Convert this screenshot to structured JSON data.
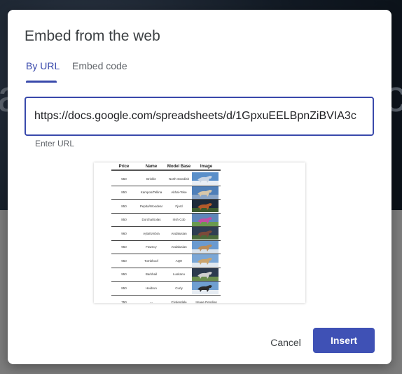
{
  "dialog": {
    "title": "Embed from the web",
    "tabs": [
      {
        "label": "By URL",
        "active": true
      },
      {
        "label": "Embed code",
        "active": false
      }
    ],
    "url_field": {
      "value": "https://docs.google.com/spreadsheets/d/1GpxuEELBpnZiBVIA3c",
      "helper": "Enter URL"
    },
    "cancel_label": "Cancel",
    "insert_label": "Insert"
  },
  "preview": {
    "headers": [
      "Price",
      "Name",
      "Model Base",
      "Image"
    ],
    "rows": [
      {
        "price": "550",
        "name": "Brinkle",
        "base": "North Swedish",
        "image": ""
      },
      {
        "price": "850",
        "name": "Kampos/Tellina",
        "base": "Akhal-Teke",
        "image": ""
      },
      {
        "price": "850",
        "name": "Pepita/Woodear",
        "base": "Fjord",
        "image": ""
      },
      {
        "price": "850",
        "name": "Dorcha/Solas",
        "base": "Irish Cob",
        "image": ""
      },
      {
        "price": "960",
        "name": "Ayla/Umbra",
        "base": "Andalusian",
        "image": ""
      },
      {
        "price": "950",
        "name": "Fawncy",
        "base": "Andalusian",
        "image": ""
      },
      {
        "price": "950",
        "name": "Tombhoof",
        "base": "AQH",
        "image": ""
      },
      {
        "price": "950",
        "name": "Barkhail",
        "base": "Lusitano",
        "image": ""
      },
      {
        "price": "850",
        "name": "Heidrun",
        "base": "Curly",
        "image": ""
      },
      {
        "price": "750",
        "name": "---",
        "base": "Clydesdale",
        "image": "Image Pending"
      }
    ]
  },
  "colors": {
    "accent": "#3f51b5",
    "tab_active": "#3949ab",
    "text_primary": "#3c4043",
    "text_secondary": "#5f6368"
  },
  "icons": []
}
